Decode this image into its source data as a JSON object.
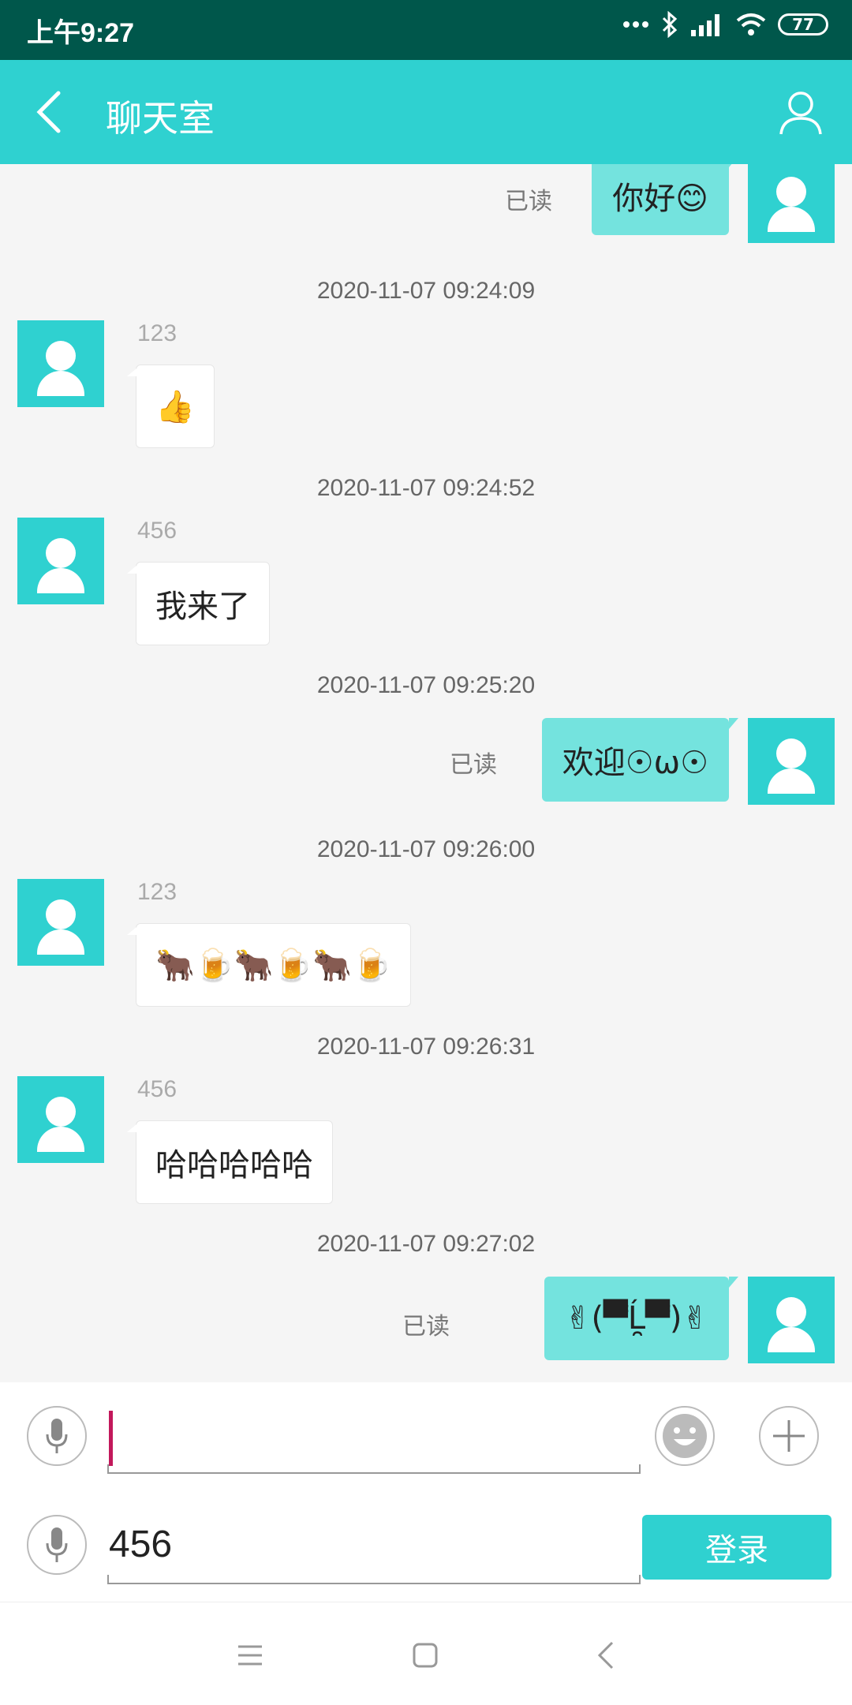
{
  "status_bar": {
    "time": "上午9:27",
    "battery": "77"
  },
  "app_bar": {
    "title": "聊天室"
  },
  "messages": [
    {
      "direction": "out",
      "text": "你好😊",
      "read": "已读"
    },
    {
      "time": "2020-11-07 09:24:09",
      "direction": "in",
      "sender": "123",
      "text": "👍"
    },
    {
      "time": "2020-11-07 09:24:52",
      "direction": "in",
      "sender": "456",
      "text": "我来了"
    },
    {
      "time": "2020-11-07 09:25:20",
      "direction": "out",
      "text": "欢迎☉ω☉",
      "read": "已读"
    },
    {
      "time": "2020-11-07 09:26:00",
      "direction": "in",
      "sender": "123",
      "text": "🐂🍺🐂🍺🐂🍺"
    },
    {
      "time": "2020-11-07 09:26:31",
      "direction": "in",
      "sender": "456",
      "text": "哈哈哈哈哈"
    },
    {
      "time": "2020-11-07 09:27:02",
      "direction": "out",
      "text": "✌(▀̿Ĺ̯▀̿)✌",
      "read": "已读"
    }
  ],
  "composer": {
    "message_value": ""
  },
  "login": {
    "value": "456",
    "button_label": "登录"
  },
  "colors": {
    "accent": "#2fd1d0",
    "status_bar": "#00574b",
    "bubble_out": "#74e3de"
  }
}
